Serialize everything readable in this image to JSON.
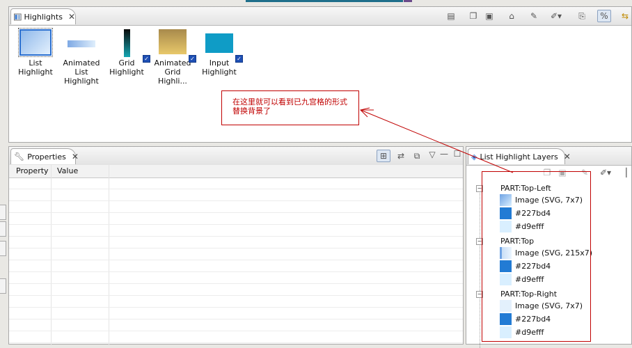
{
  "highlights_view": {
    "tab_label": "Highlights",
    "items": [
      {
        "line1": "List Highlight",
        "line2": ""
      },
      {
        "line1": "Animated",
        "line2": "List Highlight"
      },
      {
        "line1": "Grid",
        "line2": "Highlight"
      },
      {
        "line1": "Animated",
        "line2": "Grid Highli..."
      },
      {
        "line1": "Input",
        "line2": "Highlight"
      }
    ]
  },
  "annotation": {
    "text": "在这里就可以看到已九宫格的形式替换背景了",
    "border_color": "#c00000",
    "text_color": "#c00000"
  },
  "properties_view": {
    "tab_label": "Properties",
    "columns": [
      "Property",
      "Value"
    ]
  },
  "layers_view": {
    "tab_label": "List Highlight Layers",
    "parts": [
      {
        "name": "PART:Top-Left",
        "children": [
          {
            "label": "Image (SVG, 7x7)",
            "swatch": "image-gradient"
          },
          {
            "label": "#227bd4",
            "swatch": "#227bd4"
          },
          {
            "label": "#d9efff",
            "swatch": "#d9efff"
          }
        ]
      },
      {
        "name": "PART:Top",
        "children": [
          {
            "label": "Image (SVG, 215x7)",
            "swatch": "image-gradient"
          },
          {
            "label": "#227bd4",
            "swatch": "#227bd4"
          },
          {
            "label": "#d9efff",
            "swatch": "#d9efff"
          }
        ]
      },
      {
        "name": "PART:Top-Right",
        "children": [
          {
            "label": "Image (SVG, 7x7)",
            "swatch": "image-light"
          },
          {
            "label": "#227bd4",
            "swatch": "#227bd4"
          },
          {
            "label": "#d9efff",
            "swatch": "#d9efff"
          }
        ]
      }
    ]
  },
  "icons": {
    "highlights_tab": "highlights-view-icon",
    "properties_tab": "wrench-icon",
    "layers_tab": "layers-icon",
    "close": "close-icon"
  }
}
